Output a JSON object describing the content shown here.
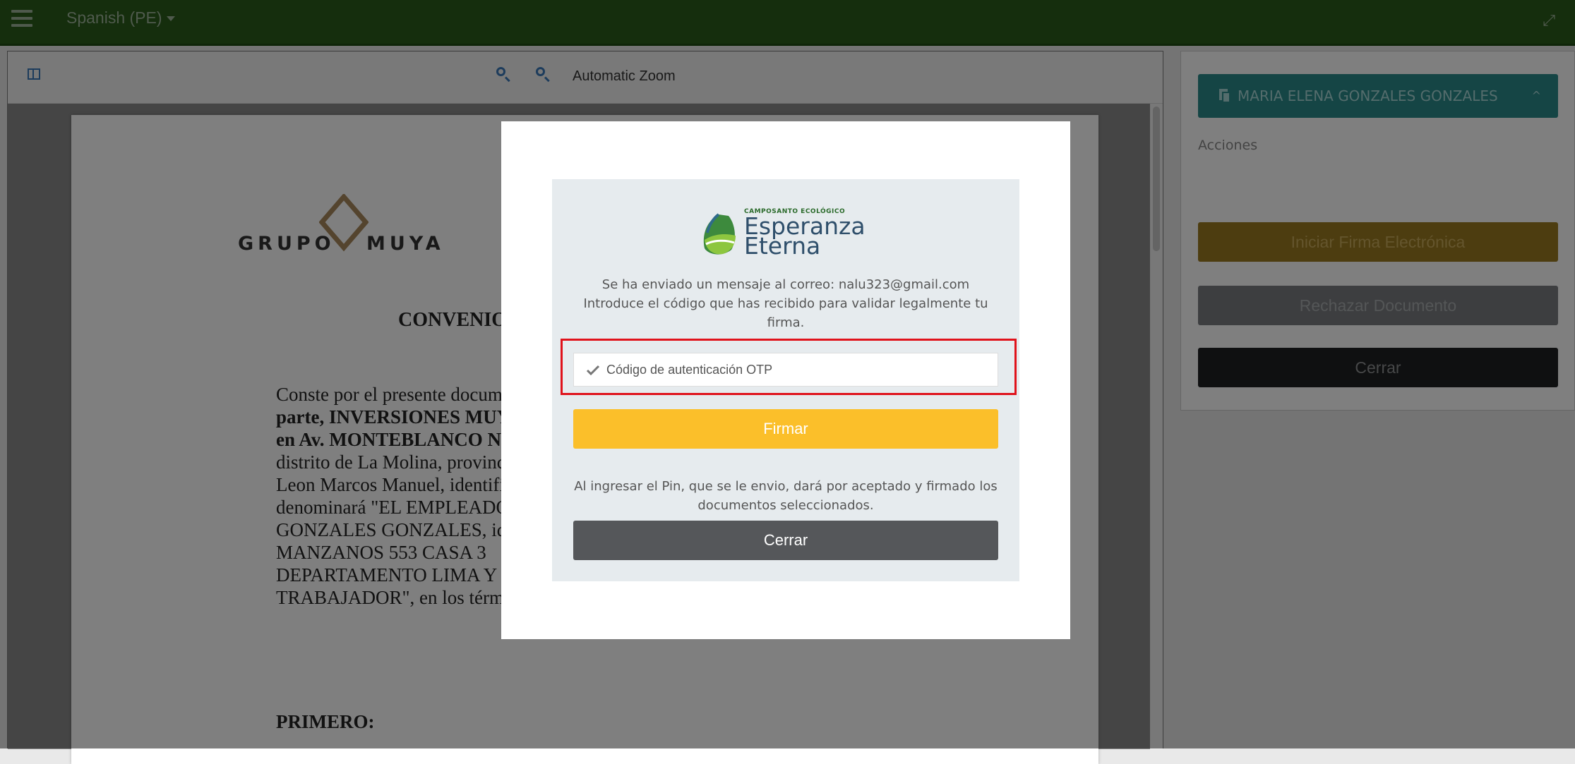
{
  "topbar": {
    "language": "Spanish (PE)"
  },
  "viewer": {
    "zoom_label": "Automatic Zoom"
  },
  "document": {
    "logo_left": "GRUPO",
    "logo_right": "MUYA",
    "title_partial": "CONVENIO",
    "body_lines": [
      "Conste por el presente documento",
      "parte, INVERSIONES MUYA S.",
      "en Av. MONTEBLANCO NRO",
      "distrito de La Molina, provincia y",
      "Leon Marcos Manuel, identifica",
      "denominará \"EL EMPLEADOR",
      "GONZALES GONZALES, identi",
      "MANZANOS 553 CASA 3",
      "DEPARTAMENTO LIMA Y P.",
      "TRABAJADOR\", en los términos y condiciones siguientes."
    ],
    "heading": "PRIMERO:"
  },
  "side_panel": {
    "user_name": "MARIA ELENA GONZALES GONZALES",
    "actions_label": "Acciones",
    "start_sign_label": "Iniciar Firma Electrónica",
    "reject_label": "Rechazar Documento",
    "close_label": "Cerrar"
  },
  "modal": {
    "brand_small": "CAMPOSANTO ECOLÓGICO",
    "brand_line1": "Esperanza",
    "brand_line2": "Eterna",
    "message_line1": "Se ha enviado un mensaje al correo: nalu323@gmail.com",
    "message_line2": "Introduce el código que has recibido para validar legalmente tu firma.",
    "otp_placeholder": "Código de autenticación OTP",
    "sign_button": "Firmar",
    "note": "Al ingresar el Pin, que se le envio, dará por aceptado y firmado los documentos seleccionados.",
    "close_button": "Cerrar"
  },
  "colors": {
    "topbar": "#2a5d1a",
    "user_button": "#2a8a8a",
    "sign_button": "#fbbf2a",
    "highlight_border": "#e0121b"
  }
}
